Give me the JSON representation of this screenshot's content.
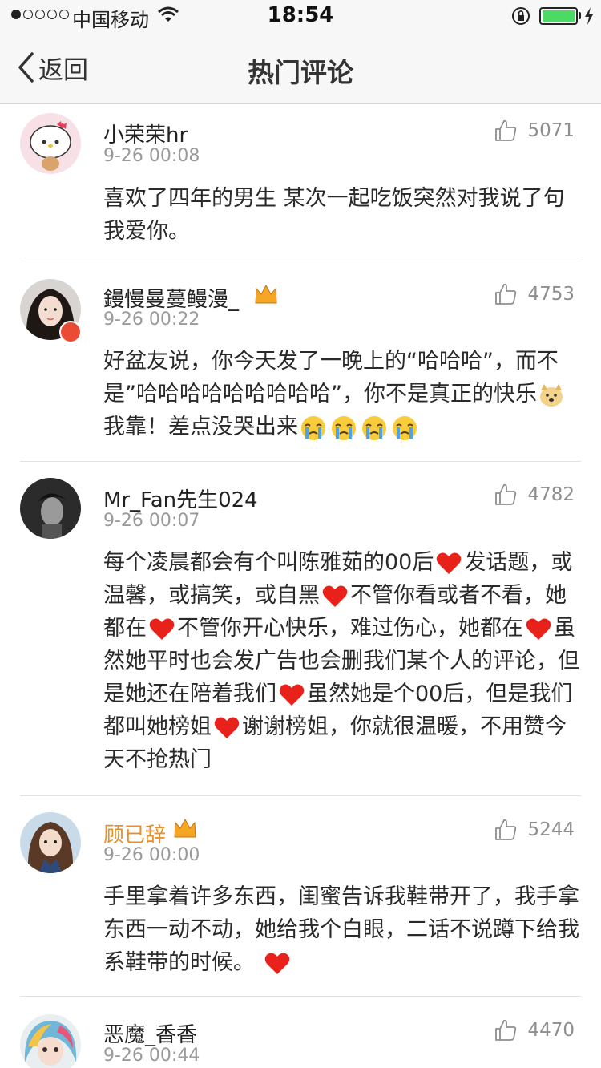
{
  "status_bar": {
    "carrier": "中国移动",
    "time": "18:54"
  },
  "nav": {
    "back_label": "返回",
    "title": "热门评论"
  },
  "comments": [
    {
      "username": "小荣荣hr",
      "time": "9-26 00:08",
      "likes": "5071",
      "text_parts": [
        "喜欢了四年的男生  某次一起吃饭突然对我说了句  我爱你。"
      ]
    },
    {
      "username": "鏝慢曼蔓鳗漫_",
      "time": "9-26 00:22",
      "likes": "4753",
      "text_parts": [
        "好盆友说，你今天发了一晚上的“哈哈哈”，而不是”哈哈哈哈哈哈哈哈哈”，你不是真正的快乐",
        "我靠！差点没哭出来"
      ]
    },
    {
      "username": "Mr_Fan先生024",
      "time": "9-26 00:07",
      "likes": "4782",
      "text_parts": [
        "每个凌晨都会有个叫陈雅茹的00后",
        "发话题，或温馨，或搞笑，或自黑",
        "不管你看或者不看，她都在",
        "不管你开心快乐，难过伤心，她都在",
        "虽然她平时也会发广告也会删我们某个人的评论，但是她还在陪着我们",
        "虽然她是个00后，但是我们都叫她榜姐",
        "谢谢榜姐，你就很温暖，不用赞今天不抢热门"
      ]
    },
    {
      "username": "顾已辞",
      "time": "9-26 00:00",
      "likes": "5244",
      "text_parts": [
        "手里拿着许多东西，闺蜜告诉我鞋带开了，我手拿东西一动不动，她给我个白眼，二话不说蹲下给我系鞋带的时候。"
      ]
    },
    {
      "username": "恶魔_香香",
      "time": "9-26 00:44",
      "likes": "4470",
      "text_parts": []
    }
  ],
  "icons": {
    "back": "chevron-left-icon",
    "like": "thumbs-up-icon",
    "heart": "red-heart-icon",
    "crying": "crying-face-icon",
    "doge": "doge-face-icon",
    "crown": "gold-crown-icon"
  },
  "colors": {
    "nav_bg": "#f7f7f7",
    "battery": "#4cd964",
    "heart": "#e8221b",
    "gold_name": "#e8912a",
    "timestamp": "#9a9a9a"
  }
}
